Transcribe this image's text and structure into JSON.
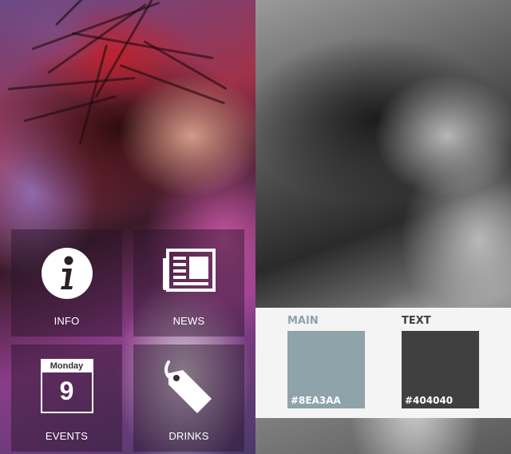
{
  "tiles": {
    "info": {
      "label": "INFO",
      "icon": "info-icon"
    },
    "news": {
      "label": "NEWS",
      "icon": "newspaper-icon"
    },
    "events": {
      "label": "EVENTS",
      "icon": "calendar-icon",
      "calendar_weekday": "Monday",
      "calendar_day": "9"
    },
    "drinks": {
      "label": "DRINKS",
      "icon": "tag-icon"
    }
  },
  "palette": {
    "main": {
      "title": "MAIN",
      "hex": "#8EA3AA",
      "color": "#8EA3AA",
      "title_color": "#8EA3AA"
    },
    "text": {
      "title": "TEXT",
      "hex": "#404040",
      "color": "#404040",
      "title_color": "#404040"
    }
  }
}
